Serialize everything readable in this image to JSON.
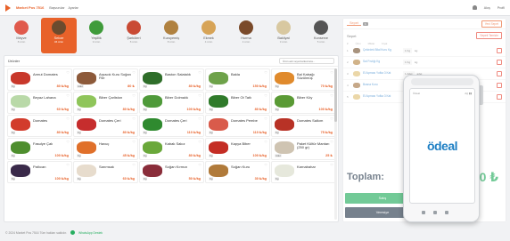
{
  "header": {
    "store_name": "Market Pos 7516",
    "links": [
      "Başvurular",
      "Ayarlar"
    ],
    "right_links": [
      "Akış",
      "Profil"
    ]
  },
  "categories": [
    {
      "name": "Meyve",
      "count": "8 ürün",
      "color": "#e05a4c"
    },
    {
      "name": "Sebze",
      "count": "46 ürün",
      "color": "#6b4b2e",
      "active": true
    },
    {
      "name": "Yeşillik",
      "count": "9 ürün",
      "color": "#3f9b3a"
    },
    {
      "name": "Şarküteri",
      "count": "8 ürün",
      "color": "#c94a34"
    },
    {
      "name": "Kuruyemiş",
      "count": "8 ürün",
      "color": "#b0813f"
    },
    {
      "name": "Ekmek",
      "count": "4 ürün",
      "color": "#d7a457"
    },
    {
      "name": "Hurma",
      "count": "4 ürün",
      "color": "#7a4a2a"
    },
    {
      "name": "Bakliyat",
      "count": "3 ürün",
      "color": "#d8c8a0"
    },
    {
      "name": "Konserve",
      "count": "5 ürün",
      "color": "#555555"
    }
  ],
  "products_panel": {
    "title": "Ürünler",
    "search_placeholder": "Ürün adı veya barkod ara..."
  },
  "products": [
    {
      "name": "Armut Domates",
      "price": "80 ₺/kg",
      "badge": "Kg",
      "color": "#c8382b"
    },
    {
      "name": "Arpacık Kuru Soğan File",
      "price": "80 ₺",
      "badge": "Adet",
      "color": "#8d5a3a"
    },
    {
      "name": "Baston Salatalık",
      "price": "80 ₺/kg",
      "badge": "Kg",
      "color": "#2f6e2a"
    },
    {
      "name": "Bakla",
      "price": "150 ₺/kg",
      "badge": "Kg",
      "color": "#6ea24a"
    },
    {
      "name": "Bal Kabağı Süzülmüş",
      "price": "70 ₺/kg",
      "badge": "Kg",
      "color": "#e08a2c"
    },
    {
      "name": "Beyaz Lahana",
      "price": "60 ₺/kg",
      "badge": "Kg",
      "color": "#b9d9a8"
    },
    {
      "name": "Biber Çarliston",
      "price": "80 ₺/kg",
      "badge": "Kg",
      "color": "#8fc55a"
    },
    {
      "name": "Biber Dolmalık",
      "price": "100 ₺/kg",
      "badge": "Kg",
      "color": "#4f9a3a"
    },
    {
      "name": "Biber Ot Tatlı",
      "price": "80 ₺/kg",
      "badge": "Kg",
      "color": "#2f7a2a"
    },
    {
      "name": "Biber Köy",
      "price": "100 ₺/kg",
      "badge": "Kg",
      "color": "#5a9a35"
    },
    {
      "name": "Domates",
      "price": "80 ₺/kg",
      "badge": "Kg",
      "color": "#d23c2c"
    },
    {
      "name": "Domates Çeri",
      "price": "80 ₺/kg",
      "badge": "Kg",
      "color": "#c62d2d"
    },
    {
      "name": "Domates Çeri",
      "price": "110 ₺/kg",
      "badge": "Kg",
      "color": "#2f8a2f"
    },
    {
      "name": "Domates Pembe",
      "price": "110 ₺/kg",
      "badge": "Kg",
      "color": "#d95b4b"
    },
    {
      "name": "Domates Salkım",
      "price": "75 ₺/kg",
      "badge": "Kg",
      "color": "#b83226"
    },
    {
      "name": "Fasulye Çalı",
      "price": "100 ₺/kg",
      "badge": "Kg",
      "color": "#4e8e2e"
    },
    {
      "name": "Havuç",
      "price": "45 ₺/kg",
      "badge": "Kg",
      "color": "#e0702a"
    },
    {
      "name": "Kabak Sakız",
      "price": "80 ₺/kg",
      "badge": "Kg",
      "color": "#6aa83a"
    },
    {
      "name": "Kapya Biber",
      "price": "100 ₺/kg",
      "badge": "Kg",
      "color": "#c42d24"
    },
    {
      "name": "Paket Kültür Mantarı (250 gr)",
      "price": "25 ₺",
      "badge": "Adet",
      "color": "#cfc4b2"
    },
    {
      "name": "Patlıcan",
      "price": "100 ₺/kg",
      "badge": "Kg",
      "color": "#3a2a4a"
    },
    {
      "name": "Sarımsak",
      "price": "60 ₺/kg",
      "badge": "Kg",
      "color": "#e7dccd"
    },
    {
      "name": "Soğan Kırmızı",
      "price": "50 ₺/kg",
      "badge": "Kg",
      "color": "#8a2d3a"
    },
    {
      "name": "Soğan Kuru",
      "price": "30 ₺/kg",
      "badge": "Kg",
      "color": "#b07a3a"
    },
    {
      "name": "Karnabahar",
      "price": "",
      "badge": "Kg",
      "color": "#e6e8dc"
    }
  ],
  "basket": {
    "tab_label": "Sepet",
    "tab_count": "1",
    "new_button": "Yeni Sepet",
    "title": "Sepet",
    "clear_button": "Sepeti Temizle",
    "columns": [
      "#",
      "Ürün",
      "Miktar",
      "Fiyat"
    ],
    "items": [
      {
        "no": "1",
        "name": "Çekirdek Bilal Kuru Kg",
        "qty": "1 Kg",
        "unit": "kg",
        "color": "#7a5a3a"
      },
      {
        "no": "2",
        "name": "Sal Fıstığı Kg",
        "qty": "1 Kg",
        "unit": "kg",
        "color": "#b98a4a"
      },
      {
        "no": "3",
        "name": "El Açması Yufka 3 Kat",
        "qty": "1 Adet",
        "unit": "adet",
        "color": "#e0c27a"
      },
      {
        "no": "4",
        "name": "Bosna Kuru",
        "qty": "1 Kg",
        "unit": "kg",
        "color": "#a87a4a"
      },
      {
        "no": "5",
        "name": "El Açması Yufka 3 Kat",
        "qty": "1 Adet",
        "unit": "adet",
        "color": "#e0c27a"
      }
    ],
    "total_label": "Toplam:",
    "total_value": "1.000 ₺",
    "sell_button": "Satış",
    "veresiye_button": "Veresiye"
  },
  "pos": {
    "brand": "Ödeal",
    "screen_logo": "ödeal",
    "status": "Ağ ▮▮"
  },
  "footer": {
    "copyright": "© 2024 Market Pos 7516 Tüm hakları saklıdır.",
    "support": "WhatsApp Destek"
  },
  "colors": {
    "accent": "#e8622a",
    "success": "#27ae60",
    "dark": "#2d3e50",
    "pos_blue": "#1e7fc4"
  }
}
